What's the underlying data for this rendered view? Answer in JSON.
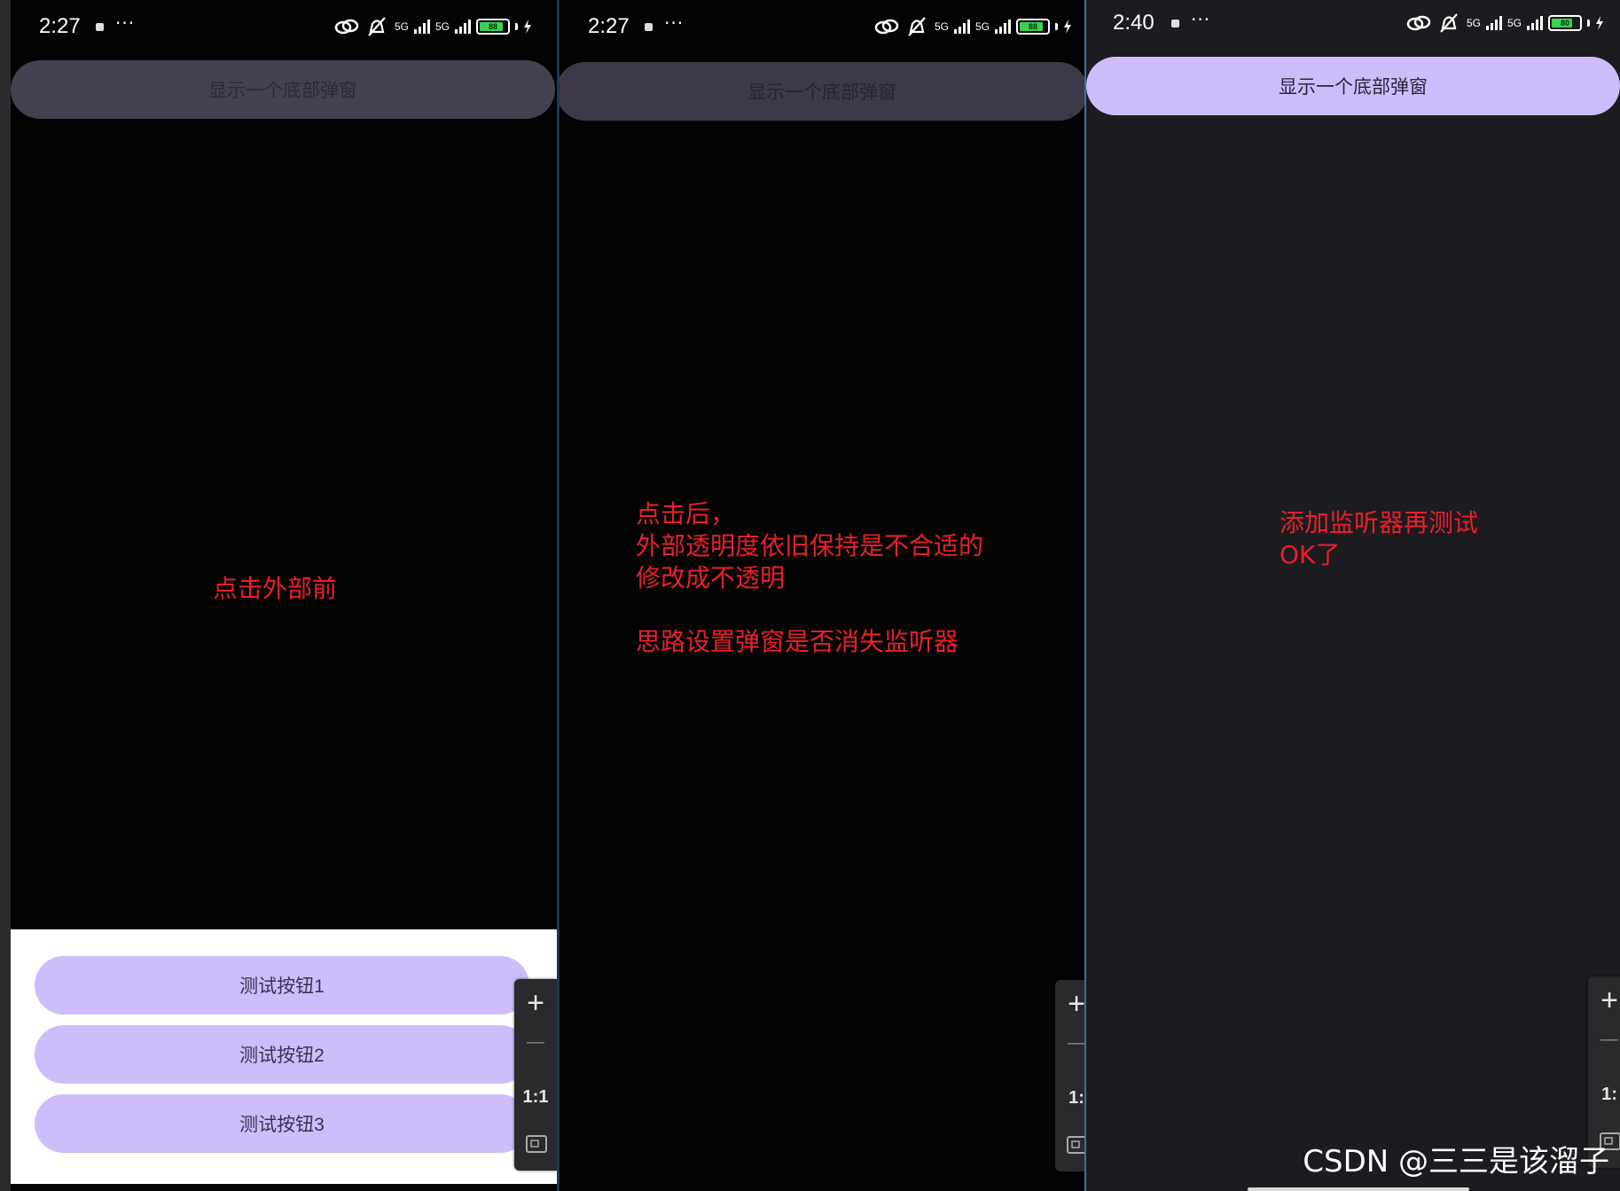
{
  "panels": [
    {
      "status": {
        "time": "2:27",
        "more": "···",
        "signal1": "5G",
        "signal2": "5G",
        "battery": "88"
      },
      "top_button": "显示一个底部弹窗",
      "annotation": "点击外部前",
      "sheet_buttons": [
        "测试按钮1",
        "测试按钮2",
        "测试按钮3"
      ],
      "zoom": {
        "plus": "+",
        "minus": "—",
        "ratio": "1:1"
      }
    },
    {
      "status": {
        "time": "2:27",
        "more": "···",
        "signal1": "5G",
        "signal2": "5G",
        "battery": "88"
      },
      "top_button": "显示一个底部弹窗",
      "annotation": "点击后，\n外部透明度依旧保持是不合适的\n修改成不透明\n\n思路设置弹窗是否消失监听器",
      "zoom": {
        "plus": "+",
        "minus": "—",
        "ratio": "1:"
      }
    },
    {
      "status": {
        "time": "2:40",
        "more": "···",
        "signal1": "5G",
        "signal2": "5G",
        "battery": "80"
      },
      "top_button": "显示一个底部弹窗",
      "annotation": "添加监听器再测试\nOK了",
      "zoom": {
        "plus": "+",
        "minus": "—",
        "ratio": "1:"
      }
    }
  ],
  "battery_level": [
    0.88,
    0.88,
    0.8
  ],
  "watermark": "CSDN @三三是该溜子",
  "colors": {
    "annotation": "#e8202a",
    "accent_button": "#cdbdfb",
    "dim_button": "#44404f",
    "battery": "#39d353"
  }
}
